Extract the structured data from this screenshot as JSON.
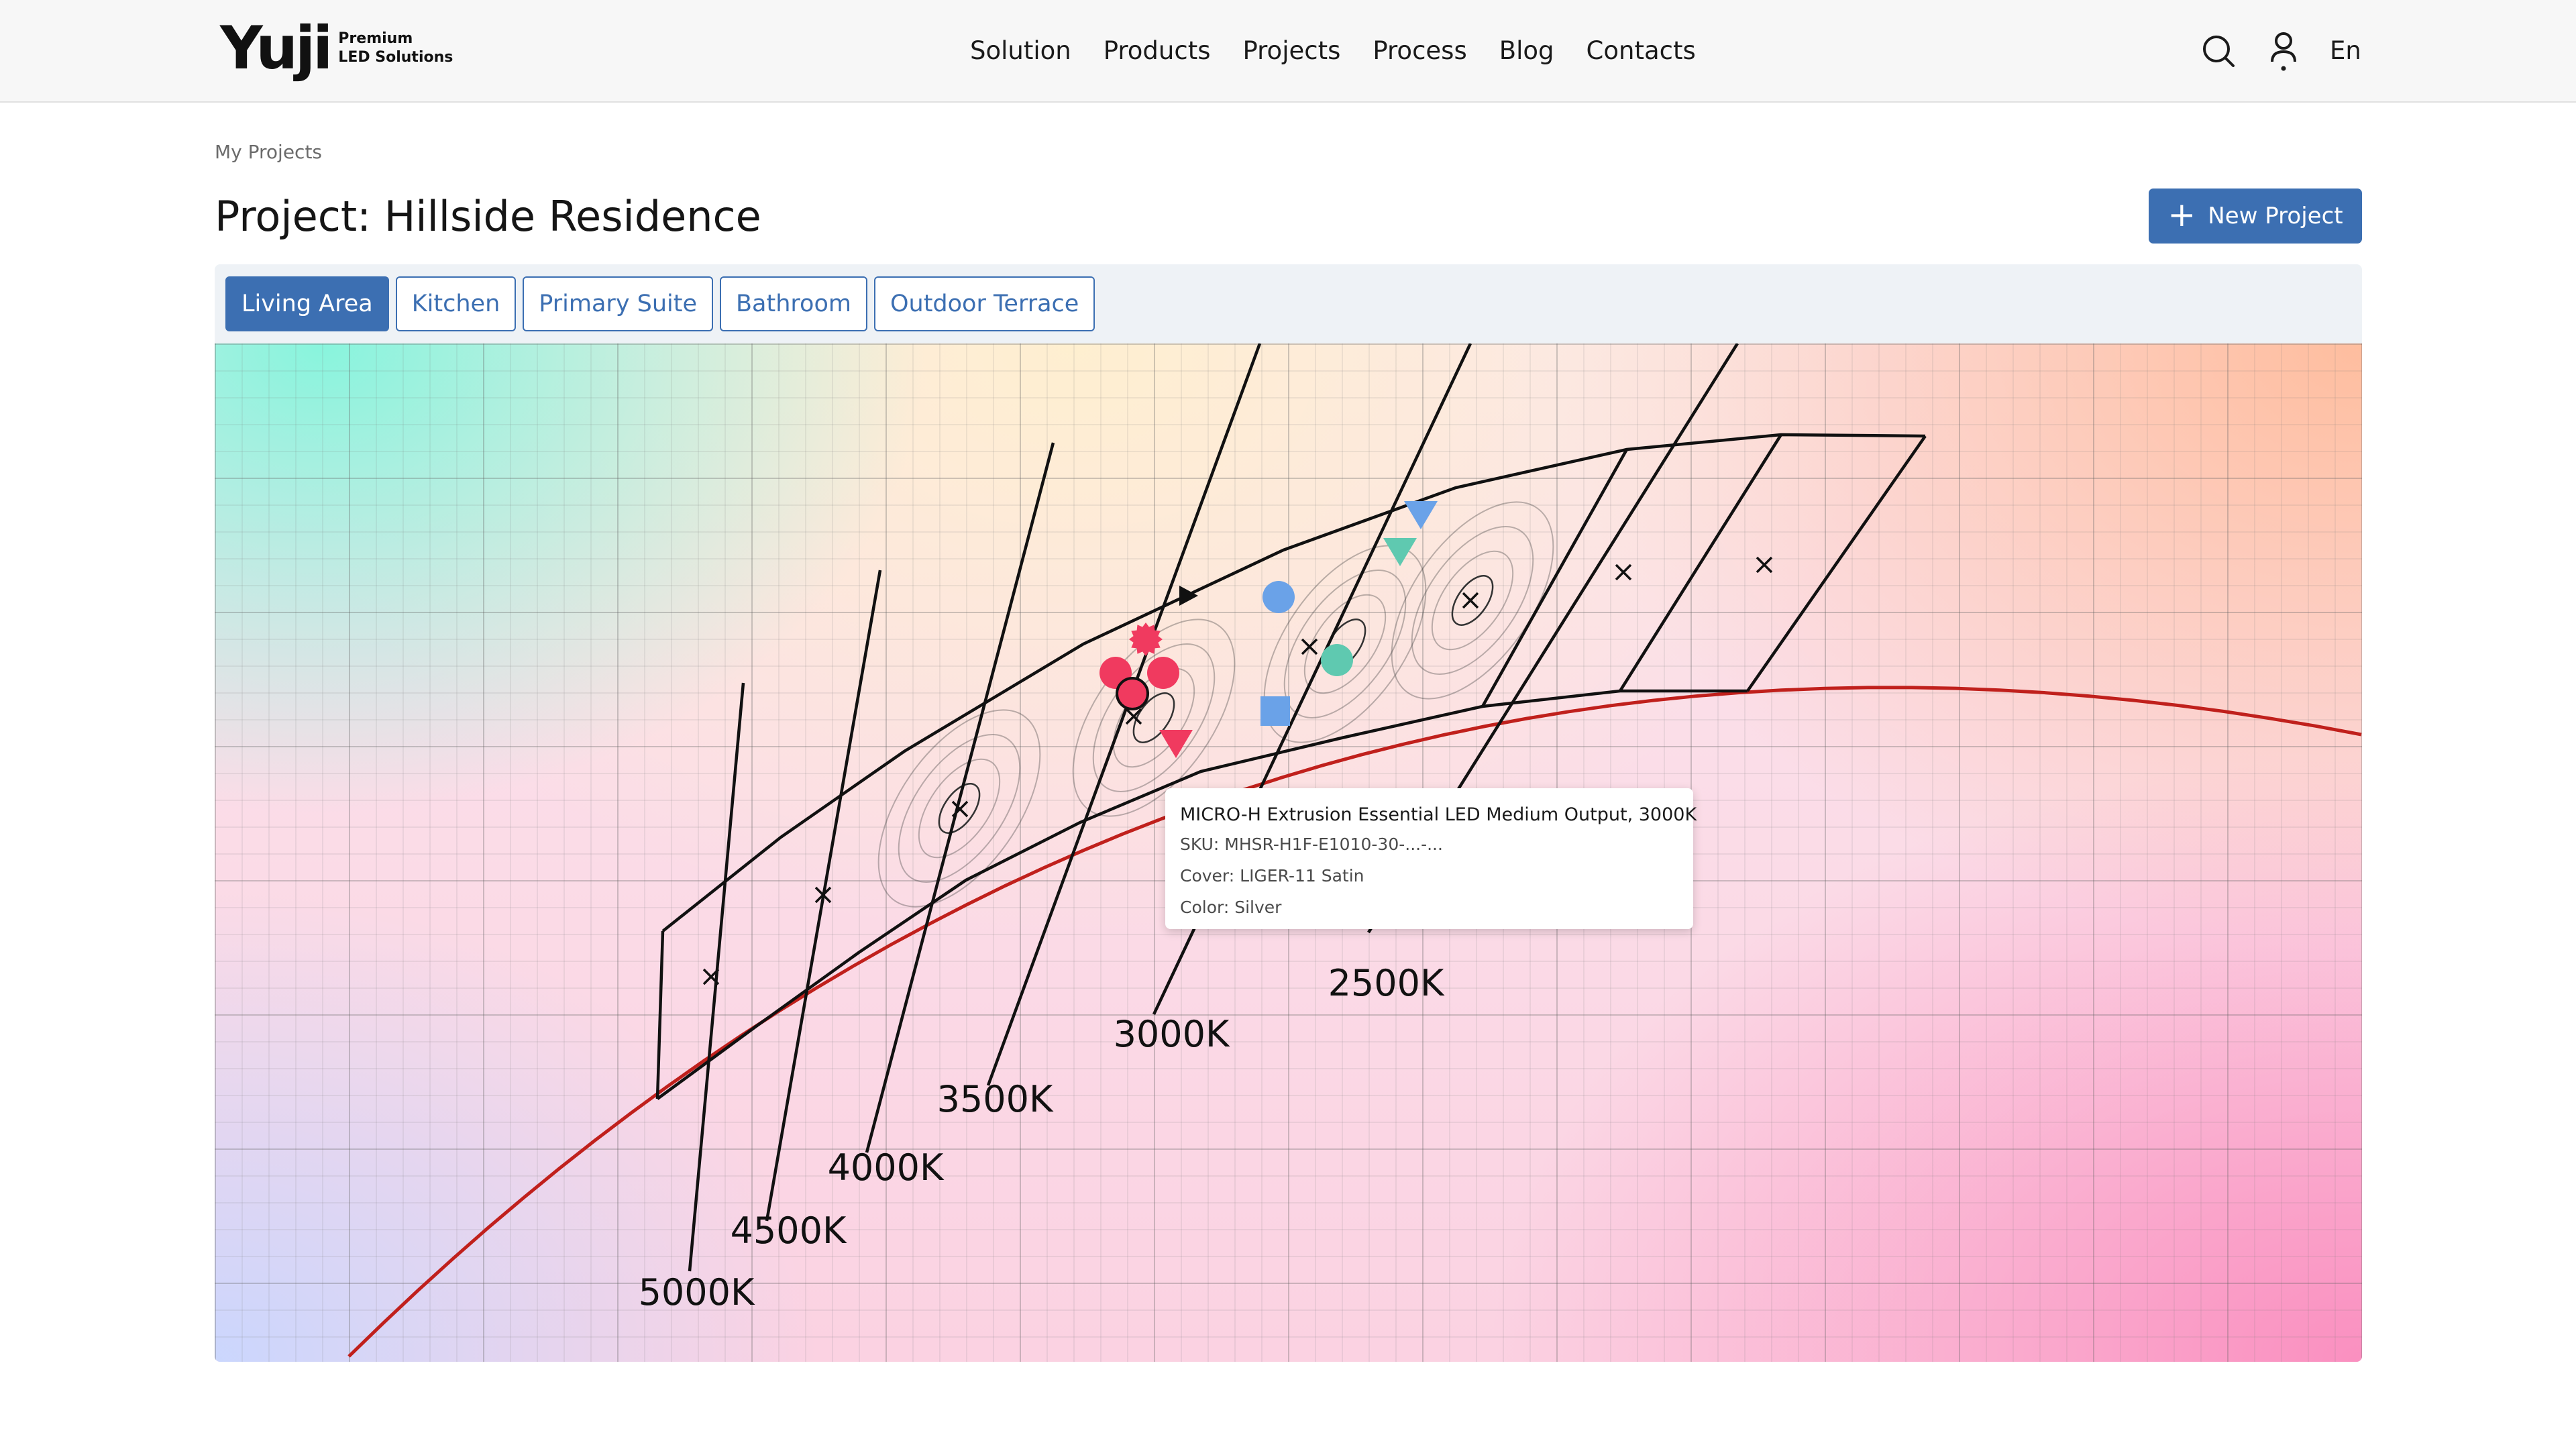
{
  "brand": {
    "name": "Yuji",
    "tagline_1": "Premium",
    "tagline_2": "LED Solutions"
  },
  "nav": {
    "items": [
      "Solution",
      "Products",
      "Projects",
      "Process",
      "Blog",
      "Contacts"
    ]
  },
  "header": {
    "language": "En"
  },
  "breadcrumb": "My Projects",
  "page": {
    "title": "Project: Hillside Residence",
    "new_project_label": "New Project"
  },
  "tabs": [
    {
      "label": "Living Area",
      "active": true
    },
    {
      "label": "Kitchen",
      "active": false
    },
    {
      "label": "Primary Suite",
      "active": false
    },
    {
      "label": "Bathroom",
      "active": false
    },
    {
      "label": "Outdoor Terrace",
      "active": false
    }
  ],
  "tooltip": {
    "title": "MICRO-H Extrusion Essential LED Medium Output, 3000K",
    "sku": "SKU: MHSR-H1F-E1010-30-...-...",
    "cover": "Cover: LIGER-11 Satin",
    "color": "Color: Silver"
  },
  "chart_data": {
    "type": "scatter",
    "title": "",
    "xlabel": "",
    "ylabel": "",
    "grid": true,
    "planckian_locus_color": "#c0201c",
    "cct_labels": [
      "5000K",
      "4500K",
      "4000K",
      "3500K",
      "3000K",
      "2500K"
    ],
    "markers": [
      {
        "shape": "starburst",
        "color": "#f03a5f"
      },
      {
        "shape": "circle",
        "color": "#f03a5f"
      },
      {
        "shape": "circle",
        "color": "#f03a5f"
      },
      {
        "shape": "circle-outlined",
        "color": "#f03a5f"
      },
      {
        "shape": "triangle-down",
        "color": "#f03a5f"
      },
      {
        "shape": "triangle-right",
        "color": "#111111"
      },
      {
        "shape": "circle",
        "color": "#6aa2e8"
      },
      {
        "shape": "circle",
        "color": "#5fc9b0"
      },
      {
        "shape": "square",
        "color": "#6aa2e8"
      },
      {
        "shape": "triangle-down",
        "color": "#6aa2e8"
      },
      {
        "shape": "triangle-down",
        "color": "#5fc9b0"
      }
    ]
  }
}
